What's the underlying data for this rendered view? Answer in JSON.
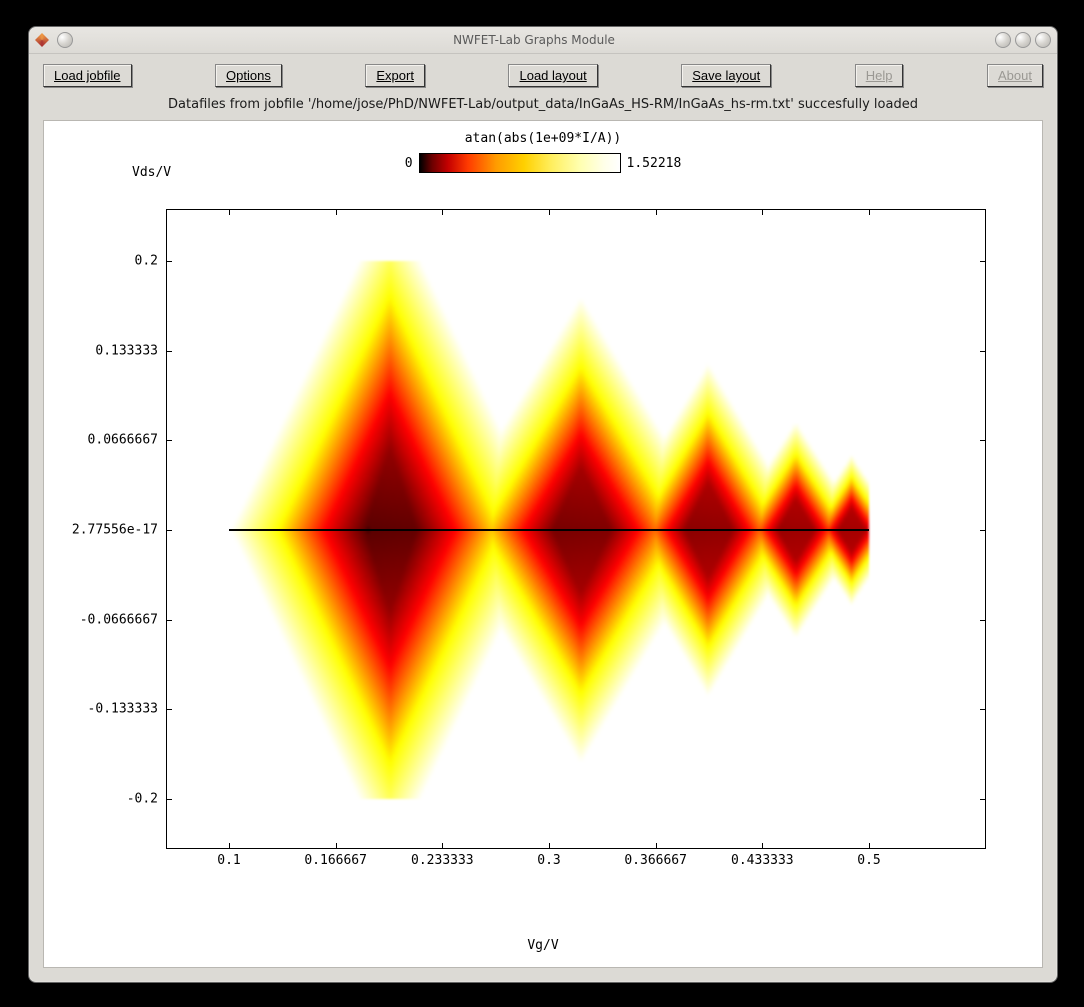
{
  "window": {
    "title": "NWFET-Lab Graphs Module"
  },
  "toolbar": {
    "load_jobfile": "Load jobfile",
    "options": "Options",
    "export": "Export",
    "load_layout": "Load layout",
    "save_layout": "Save layout",
    "help": "Help",
    "about": "About"
  },
  "status": "Datafiles from jobfile '/home/jose/PhD/NWFET-Lab/output_data/InGaAs_HS-RM/InGaAs_hs-rm.txt' succesfully loaded",
  "chart": {
    "title": "atan(abs(1e+09*I/A))",
    "colorbar": {
      "min_label": "0",
      "max_label": "1.52218",
      "min": 0,
      "max": 1.52218
    },
    "yaxis": {
      "label": "Vds/V",
      "min": -0.2,
      "max": 0.2,
      "ticks": [
        "0.2",
        "0.133333",
        "0.0666667",
        "2.77556e-17",
        "-0.0666667",
        "-0.133333",
        "-0.2"
      ]
    },
    "xaxis": {
      "label": "Vg/V",
      "min": 0.1,
      "max": 0.5,
      "ticks": [
        "0.1",
        "0.166667",
        "0.233333",
        "0.3",
        "0.366667",
        "0.433333",
        "0.5"
      ]
    }
  },
  "chart_data": {
    "type": "heatmap",
    "title": "atan(abs(1e+09*I/A))",
    "xlabel": "Vg/V",
    "ylabel": "Vds/V",
    "xlim": [
      0.1,
      0.5
    ],
    "ylim": [
      -0.2,
      0.2
    ],
    "zlim": [
      0,
      1.52218
    ],
    "colormap": "black-red-yellow-white (hot)",
    "note": "Values are atan(abs(1e9*I/A)); z≈0 is black, z≈1.52 is white. A thin black horizontal line appears at Vds≈0.",
    "diamonds": [
      {
        "center_vg": 0.2,
        "apex_vds": 0.2,
        "half_width_vg": 0.08
      },
      {
        "center_vg": 0.32,
        "apex_vds": 0.14,
        "half_width_vg": 0.07
      },
      {
        "center_vg": 0.4,
        "apex_vds": 0.1,
        "half_width_vg": 0.05
      },
      {
        "center_vg": 0.455,
        "apex_vds": 0.065,
        "half_width_vg": 0.035
      },
      {
        "center_vg": 0.49,
        "apex_vds": 0.045,
        "half_width_vg": 0.025
      }
    ]
  }
}
